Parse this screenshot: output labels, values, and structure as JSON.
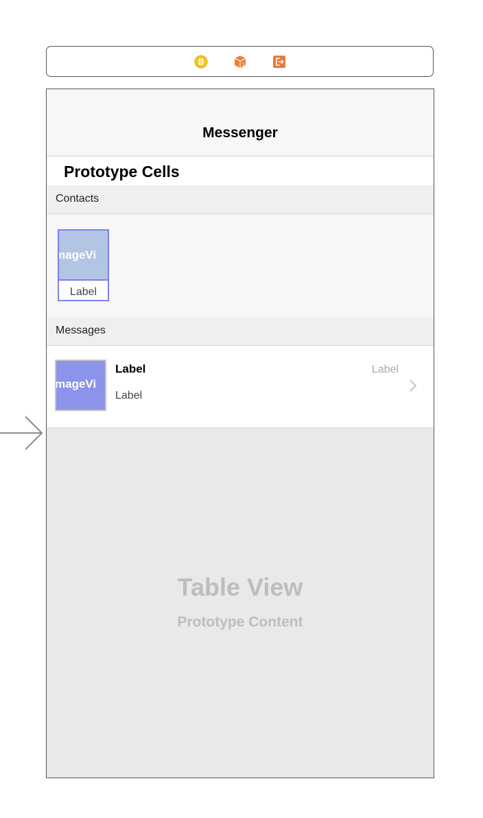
{
  "scene_dock": {
    "icons": [
      "view-controller-icon",
      "first-responder-icon",
      "exit-icon"
    ],
    "colors": {
      "view_controller": "#f5c518",
      "first_responder": "#f07f3a",
      "exit": "#ef7a3a"
    }
  },
  "navbar": {
    "title": "Messenger"
  },
  "table": {
    "prototype_header": "Prototype Cells",
    "sections": [
      {
        "label": "Contacts"
      },
      {
        "label": "Messages"
      }
    ],
    "contacts_cell": {
      "image_text": "mageVi",
      "label": "Label"
    },
    "message_cell": {
      "image_text": "mageVi",
      "title": "Label",
      "subtitle": "Label",
      "time": "Label"
    },
    "placeholder": {
      "title": "Table View",
      "subtitle": "Prototype Content"
    }
  }
}
